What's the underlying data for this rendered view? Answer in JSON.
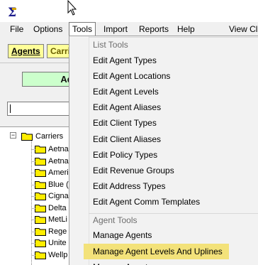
{
  "menubar": {
    "items": [
      "File",
      "Options",
      "Tools",
      "Import",
      "Reports",
      "Help",
      "View Cl"
    ]
  },
  "left_panel": {
    "tab_agents": "Agents",
    "tab_carriers": "Carri",
    "add_button": "Add",
    "tree": {
      "root": "Carriers",
      "children": [
        "Aetna",
        "Aetna",
        "Ameri",
        "Blue (",
        "Cigna",
        "Delta",
        "MetLi",
        "Rege",
        "Unite",
        "Wellp"
      ]
    }
  },
  "tools_menu": {
    "list_tools_header": "List Tools",
    "list_items": [
      "Edit Agent Types",
      "Edit Agent Locations",
      "Edit Agent Levels",
      "Edit Agent Aliases",
      "Edit Client Types",
      "Edit Client Aliases",
      "Edit Policy Types",
      "Edit Revenue Groups",
      "Edit Address Types",
      "Edit Agent Comm Templates"
    ],
    "agent_tools_header": "Agent Tools",
    "agent_items": [
      "Manage Agents",
      "Manage Agent Levels And Uplines",
      "Manage Agents"
    ],
    "highlighted_item": "Manage Agent Levels And Uplines"
  },
  "colors": {
    "highlight": "#f3e27a",
    "agents_tab": "#ffff99",
    "add_button": "#ccffcc",
    "folder": "#ffee00"
  }
}
